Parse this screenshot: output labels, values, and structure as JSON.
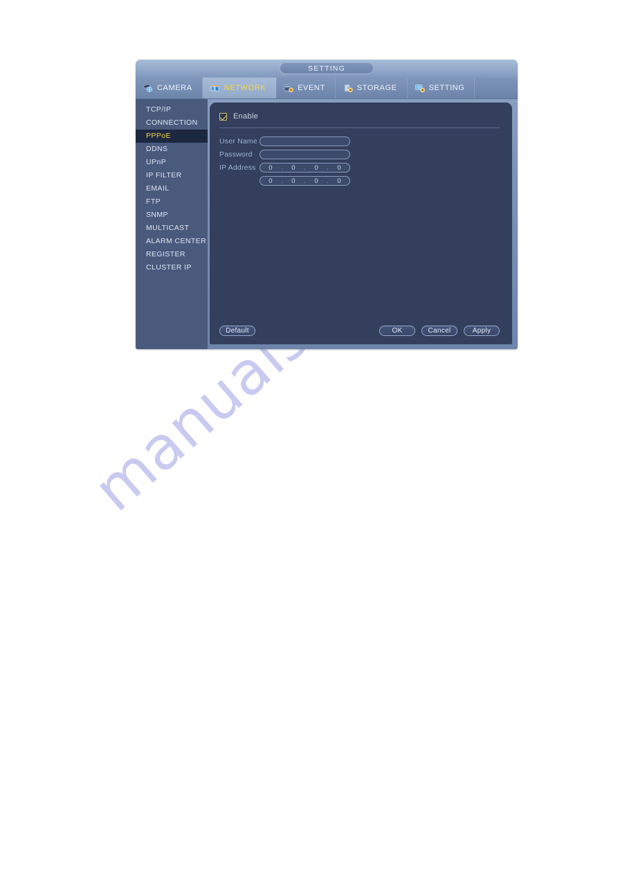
{
  "window": {
    "title": "SETTING"
  },
  "tabs": [
    {
      "label": "CAMERA",
      "icon": "camera-icon",
      "active": false
    },
    {
      "label": "NETWORK",
      "icon": "network-icon",
      "active": true
    },
    {
      "label": "EVENT",
      "icon": "event-icon",
      "active": false
    },
    {
      "label": "STORAGE",
      "icon": "storage-icon",
      "active": false
    },
    {
      "label": "SETTING",
      "icon": "setting-icon",
      "active": false
    }
  ],
  "sidebar": {
    "items": [
      {
        "label": "TCP/IP",
        "selected": false
      },
      {
        "label": "CONNECTION",
        "selected": false
      },
      {
        "label": "PPPoE",
        "selected": true
      },
      {
        "label": "DDNS",
        "selected": false
      },
      {
        "label": "UPnP",
        "selected": false
      },
      {
        "label": "IP FILTER",
        "selected": false
      },
      {
        "label": "EMAIL",
        "selected": false
      },
      {
        "label": "FTP",
        "selected": false
      },
      {
        "label": "SNMP",
        "selected": false
      },
      {
        "label": "MULTICAST",
        "selected": false
      },
      {
        "label": "ALARM CENTER",
        "selected": false
      },
      {
        "label": "REGISTER",
        "selected": false
      },
      {
        "label": "CLUSTER IP",
        "selected": false
      }
    ]
  },
  "form": {
    "enable": {
      "label": "Enable",
      "checked": true
    },
    "user_name": {
      "label": "User Name",
      "value": "",
      "placeholder": ""
    },
    "password": {
      "label": "Password",
      "value": "",
      "placeholder": ""
    },
    "ip_address": {
      "label": "IP Address",
      "rows": [
        {
          "octets": [
            "0",
            "0",
            "0",
            "0"
          ],
          "separator": "."
        },
        {
          "octets": [
            "0",
            "0",
            "0",
            "0"
          ],
          "separator": "."
        }
      ]
    }
  },
  "footer": {
    "default_label": "Default",
    "ok_label": "OK",
    "cancel_label": "Cancel",
    "apply_label": "Apply"
  },
  "watermark": {
    "text": "manualshive.com"
  },
  "colors": {
    "accent_yellow": "#f5d64e",
    "panel_bg": "#333f5c",
    "sidebar_bg": "#4a5a7d",
    "selected_bg": "#1d2740",
    "label_blue": "#9fb2d4",
    "watermark": "#c9caf0"
  }
}
